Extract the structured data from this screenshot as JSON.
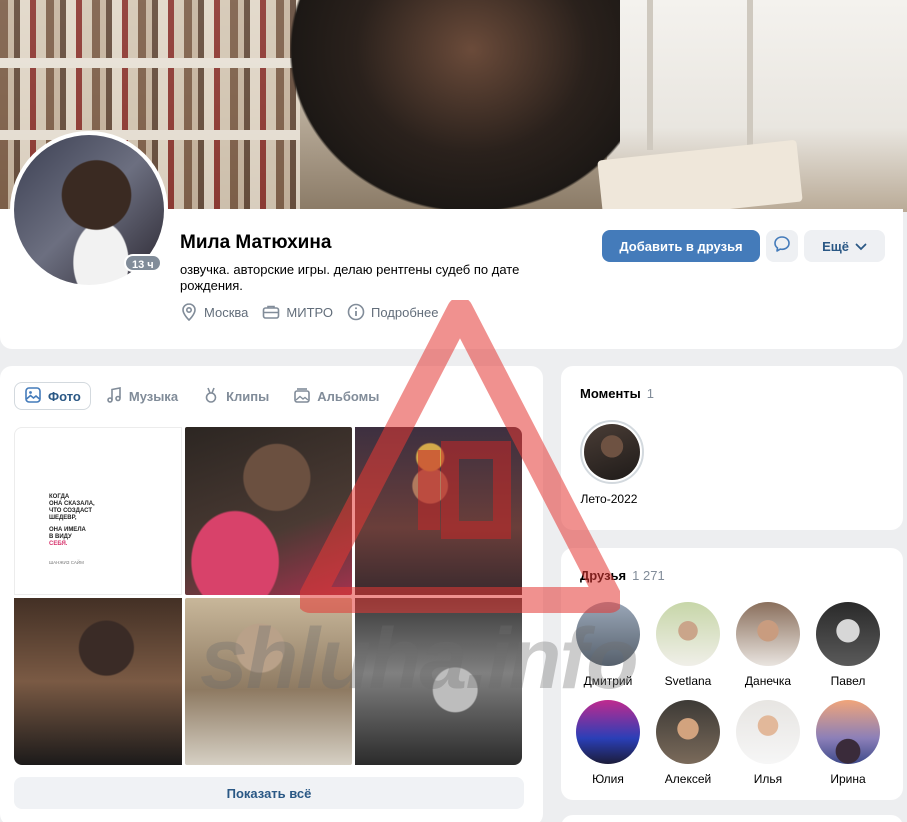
{
  "profile": {
    "name": "Мила Матюхина",
    "status": "озвучка. авторские игры. делаю рентгены судеб по дате рождения.",
    "online_badge": "13 ч",
    "meta": {
      "city": "Москва",
      "work": "МИТРО",
      "details": "Подробнее"
    }
  },
  "actions": {
    "add_friend": "Добавить в друзья",
    "more": "Ещё"
  },
  "photos": {
    "tabs": [
      {
        "label": "Фото",
        "icon": "photo-icon",
        "active": true
      },
      {
        "label": "Музыка",
        "icon": "music-icon",
        "active": false
      },
      {
        "label": "Клипы",
        "icon": "clips-icon",
        "active": false
      },
      {
        "label": "Альбомы",
        "icon": "albums-icon",
        "active": false
      }
    ],
    "quote": {
      "line1": "КОГДА",
      "line2": "ОНА СКАЗАЛА,",
      "line3": "ЧТО СОЗДАСТ",
      "line4": "ШЕДЕВР,",
      "line5": "ОНА ИМЕЛА",
      "line6": "В ВИДУ",
      "line7": "СЕБЯ.",
      "sign": "ШАНЖИЗ САЙМ"
    },
    "show_all": "Показать всё"
  },
  "moments": {
    "title": "Моменты",
    "count": "1",
    "items": [
      {
        "label": "Лето-2022"
      }
    ]
  },
  "friends": {
    "title": "Друзья",
    "count": "1 271",
    "items": [
      {
        "name": "Дмитрий"
      },
      {
        "name": "Svetlana"
      },
      {
        "name": "Данечка"
      },
      {
        "name": "Павел"
      },
      {
        "name": "Юлия"
      },
      {
        "name": "Алексей"
      },
      {
        "name": "Илья"
      },
      {
        "name": "Ирина"
      }
    ]
  },
  "watermark": {
    "text": "shluha.info",
    "badge": "ДП"
  },
  "colors": {
    "accent": "#447bba",
    "link": "#2a5885",
    "muted": "#818c99",
    "background": "#edeef0",
    "watermark_red": "#e53935"
  }
}
